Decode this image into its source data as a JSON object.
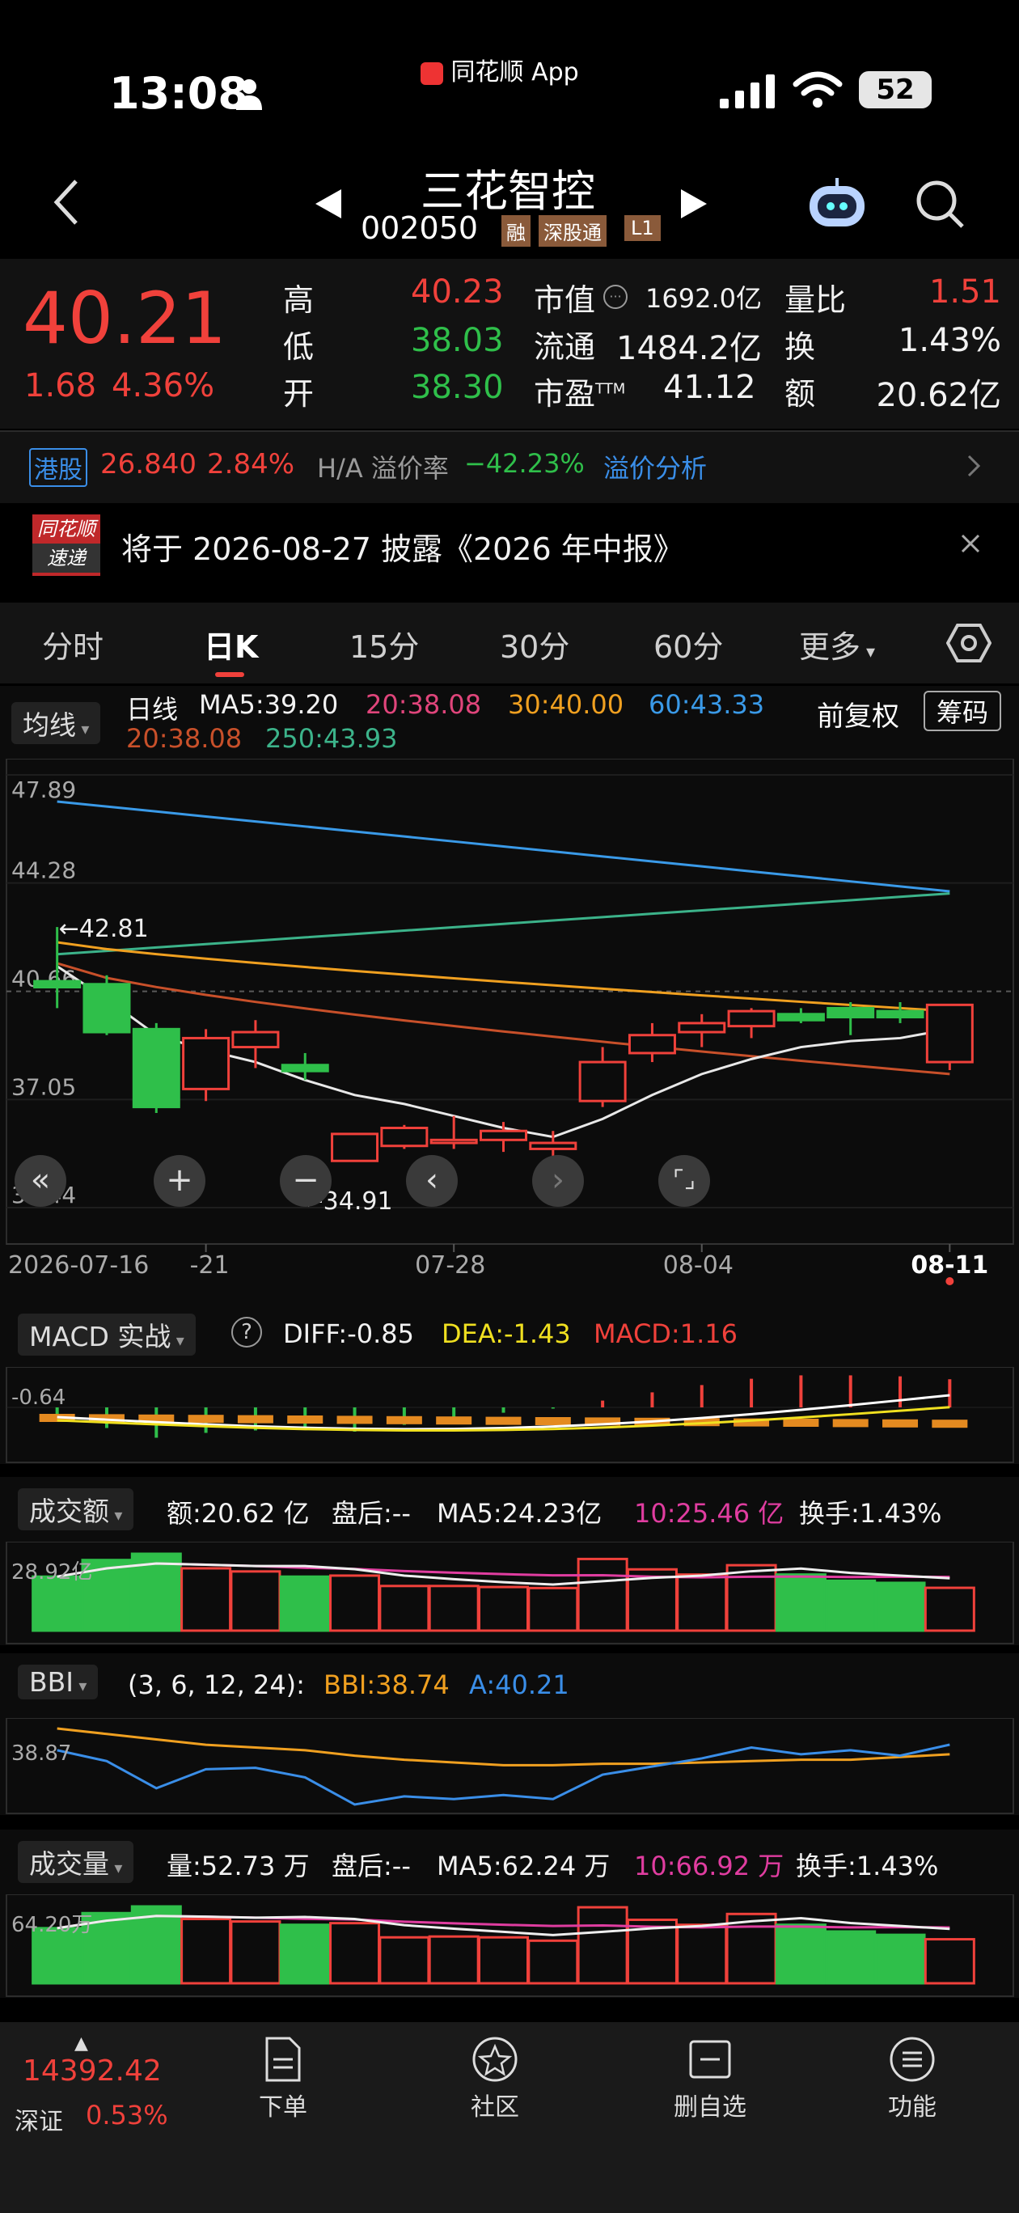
{
  "status_bar": {
    "time": "13:08",
    "app_label": "同花顺 App",
    "battery": "52"
  },
  "header": {
    "name": "三花智控",
    "code": "002050",
    "tags": [
      "融",
      "深股通",
      "L1"
    ]
  },
  "quote": {
    "price": "40.21",
    "change": "1.68",
    "change_pct": "4.36%",
    "high_label": "高",
    "high": "40.23",
    "low_label": "低",
    "low": "38.03",
    "open_label": "开",
    "open": "38.30",
    "mktcap_label": "市值",
    "mktcap": "1692.0亿",
    "float_label": "流通",
    "float": "1484.2亿",
    "pe_label": "市盈",
    "pe_sup": "TTM",
    "pe": "41.12",
    "vr_label": "量比",
    "vr": "1.51",
    "turn_label": "换",
    "turn": "1.43%",
    "amt_label": "额",
    "amt": "20.62亿"
  },
  "hk": {
    "tag": "港股",
    "price": "26.840",
    "pct": "2.84%",
    "premium_label": "H/A 溢价率",
    "premium": "−42.23%",
    "link": "溢价分析"
  },
  "notice": {
    "logo_top": "同花顺",
    "logo_bottom": "速递",
    "text": "将于 2026-08-27 披露《2026 年中报》"
  },
  "tabs": [
    "分时",
    "日K",
    "15分",
    "30分",
    "60分",
    "更多"
  ],
  "active_tab": "日K",
  "ma_bar": {
    "selector": "均线",
    "period": "日线",
    "ma5": "MA5:39.20",
    "ma20": "20:38.08",
    "ma30": "30:40.00",
    "ma60": "60:43.33",
    "ma20b": "20:38.08",
    "ma250": "250:43.93",
    "adjust": "前复权",
    "chip": "筹码"
  },
  "colors": {
    "up": "#f0413b",
    "down": "#2fbf4a",
    "ma5": "#e8e8e8",
    "ma20": "#e0457b",
    "ma30": "#f0a020",
    "ma60": "#3a9ae8",
    "ma20b": "#c8502a",
    "ma250": "#3cb38a"
  },
  "kchart": {
    "y_ticks": [
      "47.89",
      "44.28",
      "40.66",
      "37.05",
      "33.44"
    ],
    "max_note": "←42.81",
    "min_note": "←34.91",
    "x_ticks": [
      "2026-07-16",
      "-21",
      "07-28",
      "08-04",
      "08-11"
    ]
  },
  "chart_data": [
    {
      "type": "candlestick",
      "title": "日K",
      "ylim": [
        33.44,
        47.89
      ],
      "ohlc": [
        [
          41.0,
          42.81,
          40.1,
          40.8
        ],
        [
          40.9,
          41.2,
          39.2,
          39.3
        ],
        [
          39.4,
          39.6,
          36.6,
          36.8
        ],
        [
          37.4,
          39.4,
          37.0,
          39.1
        ],
        [
          38.8,
          39.7,
          38.1,
          39.3
        ],
        [
          38.2,
          38.6,
          37.7,
          38.0
        ],
        [
          35.0,
          35.9,
          35.0,
          35.9
        ],
        [
          35.5,
          36.2,
          35.4,
          36.1
        ],
        [
          35.6,
          36.5,
          35.4,
          35.7
        ],
        [
          35.7,
          36.3,
          35.3,
          36.0
        ],
        [
          35.4,
          36.0,
          35.1,
          35.6
        ],
        [
          37.0,
          38.8,
          36.8,
          38.3
        ],
        [
          38.6,
          39.6,
          38.3,
          39.2
        ],
        [
          39.3,
          39.9,
          38.8,
          39.6
        ],
        [
          39.5,
          40.1,
          39.1,
          40.0
        ],
        [
          39.9,
          40.1,
          39.6,
          39.7
        ],
        [
          40.1,
          40.3,
          39.2,
          39.8
        ],
        [
          40.0,
          40.3,
          39.6,
          39.8
        ],
        [
          38.3,
          40.23,
          38.03,
          40.21
        ]
      ]
    },
    {
      "type": "bar",
      "title": "MACD",
      "values": [
        -0.55,
        -0.85,
        -1.25,
        -1.05,
        -0.95,
        -0.88,
        -1.0,
        -0.72,
        -0.52,
        -0.22,
        -0.05,
        0.28,
        0.62,
        0.92,
        1.18,
        1.32,
        1.32,
        1.28,
        1.16
      ]
    },
    {
      "type": "bar",
      "title": "成交额",
      "values": [
        26.0,
        34.0,
        37.0,
        30.0,
        28.5,
        26.0,
        26.5,
        21.5,
        21.5,
        21.0,
        20.5,
        34.5,
        29.5,
        27.0,
        31.5,
        27.0,
        24.0,
        23.0,
        20.62
      ]
    },
    {
      "type": "line",
      "title": "BBI",
      "x": [
        1,
        2,
        3,
        4,
        5,
        6,
        7,
        8,
        9,
        10,
        11,
        12,
        13,
        14,
        15,
        16,
        17,
        18,
        19
      ],
      "series": [
        {
          "name": "BBI",
          "values": [
            41.4,
            41.0,
            40.6,
            40.2,
            40.0,
            39.8,
            39.4,
            39.1,
            38.9,
            38.7,
            38.7,
            38.8,
            38.8,
            38.9,
            39.0,
            39.1,
            39.1,
            39.3,
            39.5
          ]
        },
        {
          "name": "A",
          "values": [
            39.8,
            39.0,
            37.0,
            38.4,
            38.5,
            37.8,
            35.8,
            36.4,
            36.2,
            36.5,
            36.2,
            38.0,
            38.6,
            39.2,
            40.0,
            39.5,
            39.8,
            39.4,
            40.21
          ]
        }
      ]
    },
    {
      "type": "bar",
      "title": "成交量",
      "values": [
        66.0,
        84.0,
        92.0,
        77.0,
        74.0,
        70.0,
        72.0,
        55.0,
        56.0,
        55.0,
        51.0,
        91.0,
        76.0,
        70.0,
        83.0,
        70.0,
        62.0,
        58.0,
        52.73
      ]
    }
  ],
  "macd_bar": {
    "selector": "MACD 实战",
    "help": "?",
    "diff": "DIFF:-0.85",
    "dea": "DEA:-1.43",
    "macd": "MACD:1.16",
    "tick": "-0.64"
  },
  "amount_bar": {
    "selector": "成交额",
    "amt": "额:20.62 亿",
    "after": "盘后:--",
    "ma5": "MA5:24.23亿",
    "ma10": "10:25.46 亿",
    "turn": "换手:1.43%",
    "tick": "28.92亿"
  },
  "bbi_bar": {
    "selector": "BBI",
    "params": "(3, 6, 12, 24):",
    "bbi": "BBI:38.74",
    "a": "A:40.21",
    "tick": "38.87"
  },
  "volume_bar": {
    "selector": "成交量",
    "vol": "量:52.73 万",
    "after": "盘后:--",
    "ma5": "MA5:62.24 万",
    "ma10": "10:66.92 万",
    "turn": "换手:1.43%",
    "tick": "64.20万"
  },
  "index": {
    "value": "14392.42",
    "name": "深证",
    "pct": "0.53%"
  },
  "nav": [
    "下单",
    "社区",
    "删自选",
    "功能"
  ]
}
